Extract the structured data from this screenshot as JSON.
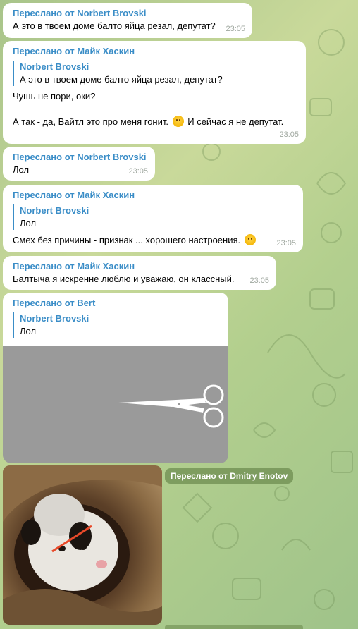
{
  "messages": [
    {
      "forwarded_from": "Переслано от Norbert Brovski",
      "text": "А это в твоем доме балто яйца резал, депутат?",
      "time": "23:05"
    },
    {
      "forwarded_from": "Переслано от Майк Хаскин",
      "reply_name": "Norbert Brovski",
      "reply_text": "А это в твоем доме балто яйца резал, депутат?",
      "line1": "Чушь не пори, оки?",
      "line2a": "А так - да, Вайтл это про меня гонит.",
      "line2b": "И сейчас я не депутат.",
      "time": "23:05"
    },
    {
      "forwarded_from": "Переслано от Norbert Brovski",
      "text": "Лол",
      "time": "23:05"
    },
    {
      "forwarded_from": "Переслано от Майк Хаскин",
      "reply_name": "Norbert Brovski",
      "reply_text": "Лол",
      "text": "Смех без причины - признак ... хорошего настроения.",
      "time": "23:05"
    },
    {
      "forwarded_from": "Переслано от Майк Хаскин",
      "text": "Балтыча я искренне люблю и уважаю, он классный.",
      "time": "23:05"
    },
    {
      "forwarded_from": "Переслано от Bert",
      "reply_name": "Norbert Brovski",
      "reply_text": "Лол"
    }
  ],
  "photo_forward": "Переслано от Dmitry Enotov",
  "icons": [
    "scissors-icon",
    "smiley-emoji-icon"
  ],
  "colors": {
    "accent": "#3a8dc7",
    "bubble": "#ffffff",
    "time": "#a0a8a0",
    "background": "#b3cf8e"
  }
}
